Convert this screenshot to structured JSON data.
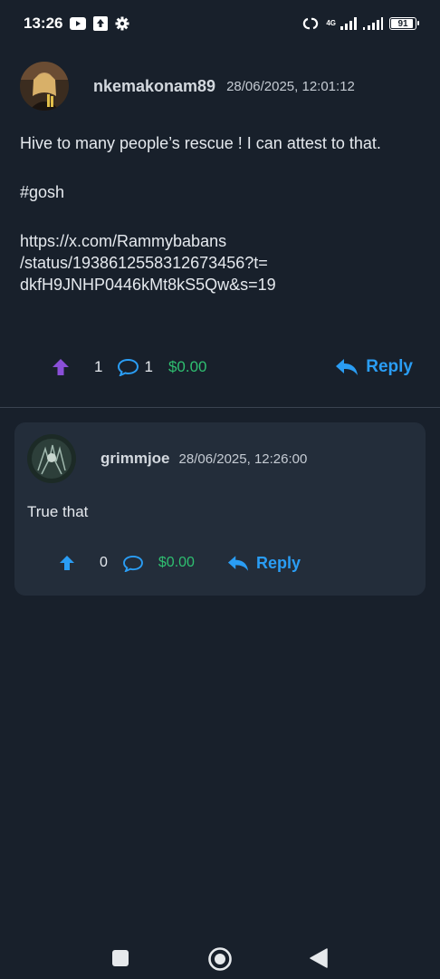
{
  "status_bar": {
    "time": "13:26",
    "network": "4G",
    "battery": "91"
  },
  "post": {
    "author": "nkemakonam89",
    "timestamp": "28/06/2025, 12:01:12",
    "paragraphs": [
      "Hive to many people’s rescue ! I can attest to that.",
      "#gosh"
    ],
    "link_lines": [
      "https://x.com/Rammybabans",
      "/status/1938612558312673456?t=",
      "dkfH9JNHP0446kMt8kS5Qw&s=19"
    ],
    "upvotes": "1",
    "comments": "1",
    "payout": "$0.00",
    "reply_label": "Reply"
  },
  "comment": {
    "author": "grimmjoe",
    "timestamp": "28/06/2025, 12:26:00",
    "text": "True that",
    "upvotes": "0",
    "payout": "$0.00",
    "reply_label": "Reply"
  },
  "colors": {
    "background": "#18202b",
    "card": "#232d3a",
    "accent_blue": "#2a9df4",
    "upvote_purple": "#8a4fd8",
    "payout_green": "#2fbf71"
  }
}
